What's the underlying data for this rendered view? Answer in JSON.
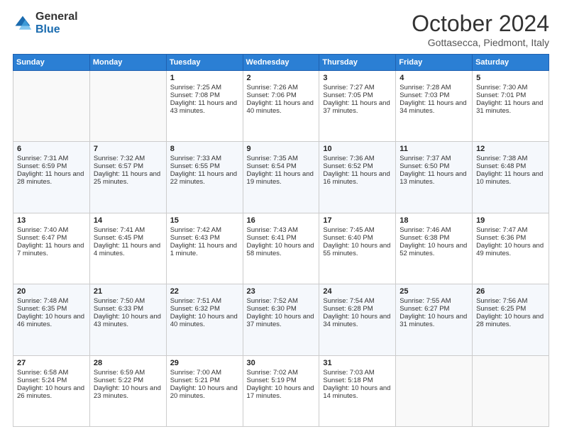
{
  "header": {
    "logo_general": "General",
    "logo_blue": "Blue",
    "month_title": "October 2024",
    "location": "Gottasecca, Piedmont, Italy"
  },
  "weekdays": [
    "Sunday",
    "Monday",
    "Tuesday",
    "Wednesday",
    "Thursday",
    "Friday",
    "Saturday"
  ],
  "weeks": [
    [
      {
        "day": "",
        "sunrise": "",
        "sunset": "",
        "daylight": ""
      },
      {
        "day": "",
        "sunrise": "",
        "sunset": "",
        "daylight": ""
      },
      {
        "day": "1",
        "sunrise": "Sunrise: 7:25 AM",
        "sunset": "Sunset: 7:08 PM",
        "daylight": "Daylight: 11 hours and 43 minutes."
      },
      {
        "day": "2",
        "sunrise": "Sunrise: 7:26 AM",
        "sunset": "Sunset: 7:06 PM",
        "daylight": "Daylight: 11 hours and 40 minutes."
      },
      {
        "day": "3",
        "sunrise": "Sunrise: 7:27 AM",
        "sunset": "Sunset: 7:05 PM",
        "daylight": "Daylight: 11 hours and 37 minutes."
      },
      {
        "day": "4",
        "sunrise": "Sunrise: 7:28 AM",
        "sunset": "Sunset: 7:03 PM",
        "daylight": "Daylight: 11 hours and 34 minutes."
      },
      {
        "day": "5",
        "sunrise": "Sunrise: 7:30 AM",
        "sunset": "Sunset: 7:01 PM",
        "daylight": "Daylight: 11 hours and 31 minutes."
      }
    ],
    [
      {
        "day": "6",
        "sunrise": "Sunrise: 7:31 AM",
        "sunset": "Sunset: 6:59 PM",
        "daylight": "Daylight: 11 hours and 28 minutes."
      },
      {
        "day": "7",
        "sunrise": "Sunrise: 7:32 AM",
        "sunset": "Sunset: 6:57 PM",
        "daylight": "Daylight: 11 hours and 25 minutes."
      },
      {
        "day": "8",
        "sunrise": "Sunrise: 7:33 AM",
        "sunset": "Sunset: 6:55 PM",
        "daylight": "Daylight: 11 hours and 22 minutes."
      },
      {
        "day": "9",
        "sunrise": "Sunrise: 7:35 AM",
        "sunset": "Sunset: 6:54 PM",
        "daylight": "Daylight: 11 hours and 19 minutes."
      },
      {
        "day": "10",
        "sunrise": "Sunrise: 7:36 AM",
        "sunset": "Sunset: 6:52 PM",
        "daylight": "Daylight: 11 hours and 16 minutes."
      },
      {
        "day": "11",
        "sunrise": "Sunrise: 7:37 AM",
        "sunset": "Sunset: 6:50 PM",
        "daylight": "Daylight: 11 hours and 13 minutes."
      },
      {
        "day": "12",
        "sunrise": "Sunrise: 7:38 AM",
        "sunset": "Sunset: 6:48 PM",
        "daylight": "Daylight: 11 hours and 10 minutes."
      }
    ],
    [
      {
        "day": "13",
        "sunrise": "Sunrise: 7:40 AM",
        "sunset": "Sunset: 6:47 PM",
        "daylight": "Daylight: 11 hours and 7 minutes."
      },
      {
        "day": "14",
        "sunrise": "Sunrise: 7:41 AM",
        "sunset": "Sunset: 6:45 PM",
        "daylight": "Daylight: 11 hours and 4 minutes."
      },
      {
        "day": "15",
        "sunrise": "Sunrise: 7:42 AM",
        "sunset": "Sunset: 6:43 PM",
        "daylight": "Daylight: 11 hours and 1 minute."
      },
      {
        "day": "16",
        "sunrise": "Sunrise: 7:43 AM",
        "sunset": "Sunset: 6:41 PM",
        "daylight": "Daylight: 10 hours and 58 minutes."
      },
      {
        "day": "17",
        "sunrise": "Sunrise: 7:45 AM",
        "sunset": "Sunset: 6:40 PM",
        "daylight": "Daylight: 10 hours and 55 minutes."
      },
      {
        "day": "18",
        "sunrise": "Sunrise: 7:46 AM",
        "sunset": "Sunset: 6:38 PM",
        "daylight": "Daylight: 10 hours and 52 minutes."
      },
      {
        "day": "19",
        "sunrise": "Sunrise: 7:47 AM",
        "sunset": "Sunset: 6:36 PM",
        "daylight": "Daylight: 10 hours and 49 minutes."
      }
    ],
    [
      {
        "day": "20",
        "sunrise": "Sunrise: 7:48 AM",
        "sunset": "Sunset: 6:35 PM",
        "daylight": "Daylight: 10 hours and 46 minutes."
      },
      {
        "day": "21",
        "sunrise": "Sunrise: 7:50 AM",
        "sunset": "Sunset: 6:33 PM",
        "daylight": "Daylight: 10 hours and 43 minutes."
      },
      {
        "day": "22",
        "sunrise": "Sunrise: 7:51 AM",
        "sunset": "Sunset: 6:32 PM",
        "daylight": "Daylight: 10 hours and 40 minutes."
      },
      {
        "day": "23",
        "sunrise": "Sunrise: 7:52 AM",
        "sunset": "Sunset: 6:30 PM",
        "daylight": "Daylight: 10 hours and 37 minutes."
      },
      {
        "day": "24",
        "sunrise": "Sunrise: 7:54 AM",
        "sunset": "Sunset: 6:28 PM",
        "daylight": "Daylight: 10 hours and 34 minutes."
      },
      {
        "day": "25",
        "sunrise": "Sunrise: 7:55 AM",
        "sunset": "Sunset: 6:27 PM",
        "daylight": "Daylight: 10 hours and 31 minutes."
      },
      {
        "day": "26",
        "sunrise": "Sunrise: 7:56 AM",
        "sunset": "Sunset: 6:25 PM",
        "daylight": "Daylight: 10 hours and 28 minutes."
      }
    ],
    [
      {
        "day": "27",
        "sunrise": "Sunrise: 6:58 AM",
        "sunset": "Sunset: 5:24 PM",
        "daylight": "Daylight: 10 hours and 26 minutes."
      },
      {
        "day": "28",
        "sunrise": "Sunrise: 6:59 AM",
        "sunset": "Sunset: 5:22 PM",
        "daylight": "Daylight: 10 hours and 23 minutes."
      },
      {
        "day": "29",
        "sunrise": "Sunrise: 7:00 AM",
        "sunset": "Sunset: 5:21 PM",
        "daylight": "Daylight: 10 hours and 20 minutes."
      },
      {
        "day": "30",
        "sunrise": "Sunrise: 7:02 AM",
        "sunset": "Sunset: 5:19 PM",
        "daylight": "Daylight: 10 hours and 17 minutes."
      },
      {
        "day": "31",
        "sunrise": "Sunrise: 7:03 AM",
        "sunset": "Sunset: 5:18 PM",
        "daylight": "Daylight: 10 hours and 14 minutes."
      },
      {
        "day": "",
        "sunrise": "",
        "sunset": "",
        "daylight": ""
      },
      {
        "day": "",
        "sunrise": "",
        "sunset": "",
        "daylight": ""
      }
    ]
  ]
}
